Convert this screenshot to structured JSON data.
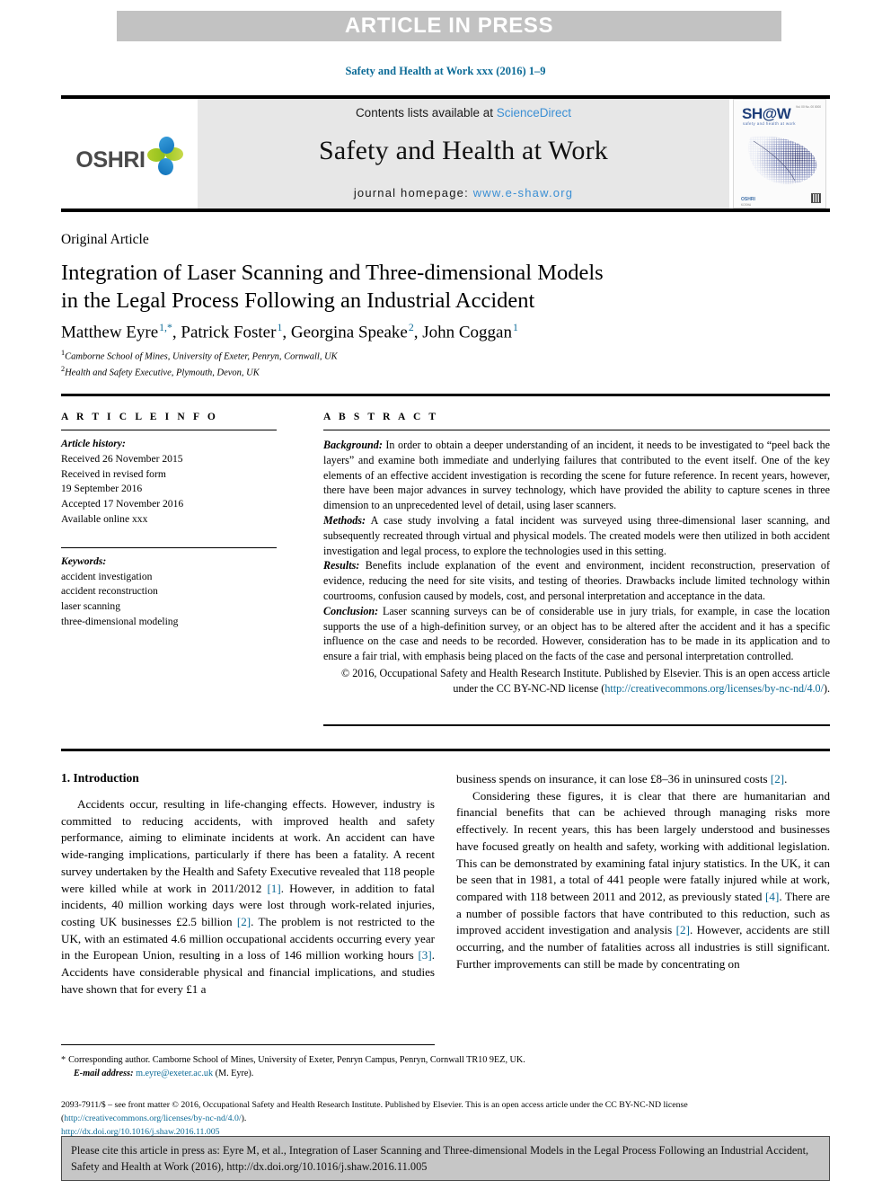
{
  "banner": {
    "text": "ARTICLE IN PRESS"
  },
  "journal_ref": "Safety and Health at Work xxx (2016) 1–9",
  "masthead": {
    "logo_word": "OSHRI",
    "contents_prefix": "Contents lists available at ",
    "contents_link": "ScienceDirect",
    "journal_title": "Safety and Health at Work",
    "homepage_prefix": "journal homepage: ",
    "homepage_url": "www.e-shaw.org",
    "cover": {
      "logo": "SH@W",
      "subtitle": "safety and health at work",
      "top_right": "Vol. 00 No. 00 0000",
      "bottom_mark": "OSHRI",
      "bottom_sub": "KOSHA"
    }
  },
  "article": {
    "type": "Original Article",
    "title_line1": "Integration of Laser Scanning and Three-dimensional Models",
    "title_line2": "in the Legal Process Following an Industrial Accident",
    "authors": [
      {
        "name": "Matthew Eyre",
        "sup": "1,*"
      },
      {
        "name": "Patrick Foster",
        "sup": "1"
      },
      {
        "name": "Georgina Speake",
        "sup": "2"
      },
      {
        "name": "John Coggan",
        "sup": "1"
      }
    ],
    "affiliations": [
      {
        "sup": "1",
        "text": "Camborne School of Mines, University of Exeter, Penryn, Cornwall, UK"
      },
      {
        "sup": "2",
        "text": "Health and Safety Executive, Plymouth, Devon, UK"
      }
    ]
  },
  "article_info": {
    "heading": "A R T I C L E  I N F O",
    "history_label": "Article history:",
    "history": [
      "Received 26 November 2015",
      "Received in revised form",
      "19 September 2016",
      "Accepted 17 November 2016",
      "Available online xxx"
    ],
    "keywords_label": "Keywords:",
    "keywords": [
      "accident investigation",
      "accident reconstruction",
      "laser scanning",
      "three-dimensional modeling"
    ]
  },
  "abstract": {
    "heading": "A B S T R A C T",
    "background_label": "Background:",
    "background_text": " In order to obtain a deeper understanding of an incident, it needs to be investigated to “peel back the layers” and examine both immediate and underlying failures that contributed to the event itself. One of the key elements of an effective accident investigation is recording the scene for future reference. In recent years, however, there have been major advances in survey technology, which have provided the ability to capture scenes in three dimension to an unprecedented level of detail, using laser scanners.",
    "methods_label": "Methods:",
    "methods_text": " A case study involving a fatal incident was surveyed using three-dimensional laser scanning, and subsequently recreated through virtual and physical models. The created models were then utilized in both accident investigation and legal process, to explore the technologies used in this setting.",
    "results_label": "Results:",
    "results_text": " Benefits include explanation of the event and environment, incident reconstruction, preservation of evidence, reducing the need for site visits, and testing of theories. Drawbacks include limited technology within courtrooms, confusion caused by models, cost, and personal interpretation and acceptance in the data.",
    "conclusion_label": "Conclusion:",
    "conclusion_text": " Laser scanning surveys can be of considerable use in jury trials, for example, in case the location supports the use of a high-definition survey, or an object has to be altered after the accident and it has a specific influence on the case and needs to be recorded. However, consideration has to be made in its application and to ensure a fair trial, with emphasis being placed on the facts of the case and personal interpretation controlled.",
    "copyright_text": "© 2016, Occupational Safety and Health Research Institute. Published by Elsevier. This is an open access article under the CC BY-NC-ND license (",
    "copyright_link": "http://creativecommons.org/licenses/by-nc-nd/4.0/",
    "copyright_suffix": ")."
  },
  "body": {
    "section_heading": "1. Introduction",
    "left_p1_a": "Accidents occur, resulting in life-changing effects. However, industry is committed to reducing accidents, with improved health and safety performance, aiming to eliminate incidents at work. An accident can have wide-ranging implications, particularly if there has been a fatality. A recent survey undertaken by the Health and Safety Executive revealed that 118 people were killed while at work in 2011/2012 ",
    "left_ref1": "[1]",
    "left_p1_b": ". However, in addition to fatal incidents, 40 million working days were lost through work-related injuries, costing UK businesses £2.5 billion ",
    "left_ref2": "[2]",
    "left_p1_c": ". The problem is not restricted to the UK, with an estimated 4.6 million occupational accidents occurring every year in the European Union, resulting in a loss of 146 million working hours ",
    "left_ref3": "[3]",
    "left_p1_d": ". Accidents have considerable physical and financial implications, and studies have shown that for every £1 a",
    "right_p1_a": "business spends on insurance, it can lose £8–36 in uninsured costs ",
    "right_ref1": "[2]",
    "right_p1_b": ".",
    "right_p2_a": "Considering these figures, it is clear that there are humanitarian and financial benefits that can be achieved through managing risks more effectively. In recent years, this has been largely understood and businesses have focused greatly on health and safety, working with additional legislation. This can be demonstrated by examining fatal injury statistics. In the UK, it can be seen that in 1981, a total of 441 people were fatally injured while at work, compared with 118 between 2011 and 2012, as previously stated ",
    "right_ref2": "[4]",
    "right_p2_b": ". There are a number of possible factors that have contributed to this reduction, such as improved accident investigation and analysis ",
    "right_ref3": "[2]",
    "right_p2_c": ". However, accidents are still occurring, and the number of fatalities across all industries is still significant. Further improvements can still be made by concentrating on"
  },
  "footnote": {
    "corresponding": "Corresponding author. Camborne School of Mines, University of Exeter, Penryn Campus, Penryn, Cornwall TR10 9EZ, UK.",
    "email_label": "E-mail address:",
    "email": "m.eyre@exeter.ac.uk",
    "email_suffix": " (M. Eyre)."
  },
  "bottom": {
    "issn_line": "2093-7911/$ – see front matter © 2016, Occupational Safety and Health Research Institute. Published by Elsevier. This is an open access article under the CC BY-NC-ND license",
    "license_open": "(",
    "license_link": "http://creativecommons.org/licenses/by-nc-nd/4.0/",
    "license_close": ").",
    "doi": "http://dx.doi.org/10.1016/j.shaw.2016.11.005",
    "cite_text": "Please cite this article in press as: Eyre M, et al., Integration of Laser Scanning and Three-dimensional Models in the Legal Process Following an Industrial Accident, Safety and Health at Work (2016), http://dx.doi.org/10.1016/j.shaw.2016.11.005"
  },
  "colors": {
    "link_blue": "#0b6a96",
    "sd_blue": "#3b8fd4",
    "banner_gray": "#c2c2c2",
    "masthead_gray": "#e7e7e7",
    "cite_box_gray": "#c6c6c6"
  }
}
